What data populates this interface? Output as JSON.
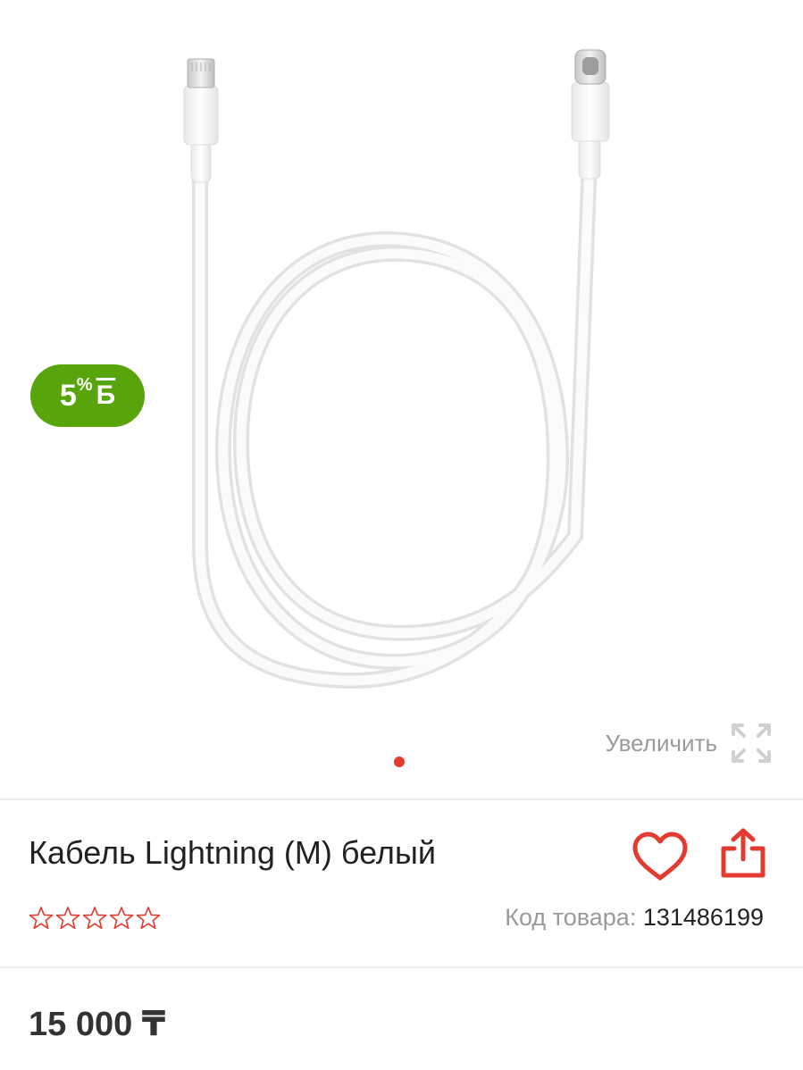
{
  "gallery": {
    "image_alt": "Кабель Lightning (M) белый",
    "bonus_badge": {
      "percent": "5",
      "percent_sign": "%",
      "currency": "Б"
    },
    "zoom_label": "Увеличить",
    "active_slide": 1,
    "slide_count": 1
  },
  "product": {
    "title": "Кабель Lightning (M) белый",
    "rating": 0,
    "rating_max": 5,
    "sku_label": "Код товара:",
    "sku_value": "131486199",
    "price": "15 000 ₸"
  },
  "colors": {
    "accent": "#e23b2f",
    "badge": "#57a50a",
    "muted_text": "#9a9a9a"
  },
  "icons": [
    "zoom-expand-icon",
    "heart-icon",
    "share-icon",
    "star-outline-icon"
  ]
}
